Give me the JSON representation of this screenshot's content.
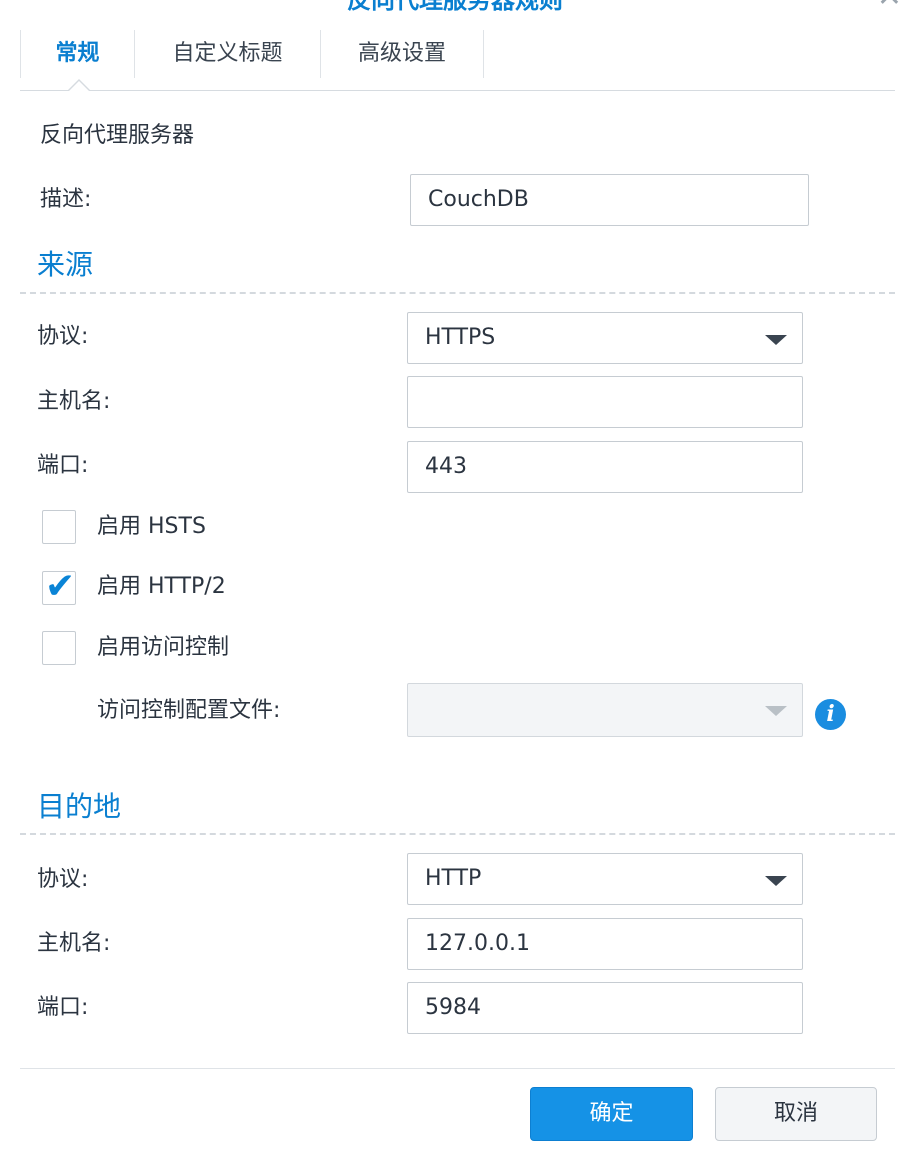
{
  "dialog": {
    "title": "反向代理服务器规则",
    "close_icon": "close-icon"
  },
  "tabs": [
    {
      "label": "常规",
      "active": true
    },
    {
      "label": "自定义标题",
      "active": false
    },
    {
      "label": "高级设置",
      "active": false
    }
  ],
  "general": {
    "heading": "反向代理服务器",
    "description_label": "描述:",
    "description_value": "CouchDB"
  },
  "source": {
    "heading": "来源",
    "protocol_label": "协议:",
    "protocol_value": "HTTPS",
    "hostname_label": "主机名:",
    "hostname_value": "",
    "port_label": "端口:",
    "port_value": "443",
    "hsts_label": "启用 HSTS",
    "hsts_checked": false,
    "http2_label": "启用 HTTP/2",
    "http2_checked": true,
    "access_control_label": "启用访问控制",
    "access_control_checked": false,
    "access_profile_label": "访问控制配置文件:",
    "access_profile_value": ""
  },
  "destination": {
    "heading": "目的地",
    "protocol_label": "协议:",
    "protocol_value": "HTTP",
    "hostname_label": "主机名:",
    "hostname_value": "127.0.0.1",
    "port_label": "端口:",
    "port_value": "5984"
  },
  "footer": {
    "ok_label": "确定",
    "cancel_label": "取消"
  },
  "colors": {
    "accent": "#0a7fd0",
    "primary_button": "#1592e6"
  }
}
